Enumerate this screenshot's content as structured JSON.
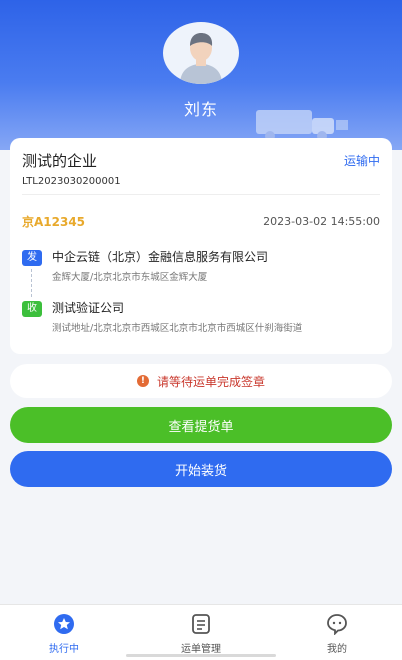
{
  "profile": {
    "name": "刘东",
    "avatar_icon": "user-avatar-icon"
  },
  "order": {
    "company": "测试的企业",
    "status": "运输中",
    "order_no": "LTL2023030200001",
    "plate": "京A12345",
    "time": "2023-03-02 14:55:00",
    "sender": {
      "tag": "发",
      "name": "中企云链（北京）金融信息服务有限公司",
      "address": "金辉大厦/北京北京市东城区金辉大厦"
    },
    "receiver": {
      "tag": "收",
      "name": "测试验证公司",
      "address": "测试地址/北京北京市西城区北京市北京市西城区什刹海街道"
    }
  },
  "notice": {
    "icon": "!",
    "text": "请等待运单完成签章"
  },
  "actions": {
    "view_label": "查看提货单",
    "load_label": "开始装货"
  },
  "tabbar": {
    "items": [
      {
        "label": "执行中",
        "icon": "star-badge-icon",
        "active": true
      },
      {
        "label": "运单管理",
        "icon": "document-list-icon",
        "active": false
      },
      {
        "label": "我的",
        "icon": "chat-face-icon",
        "active": false
      }
    ]
  },
  "colors": {
    "primary": "#2f6bf0",
    "success": "#4bbf28",
    "plate": "#e8a92c",
    "warning": "#c9382d"
  }
}
